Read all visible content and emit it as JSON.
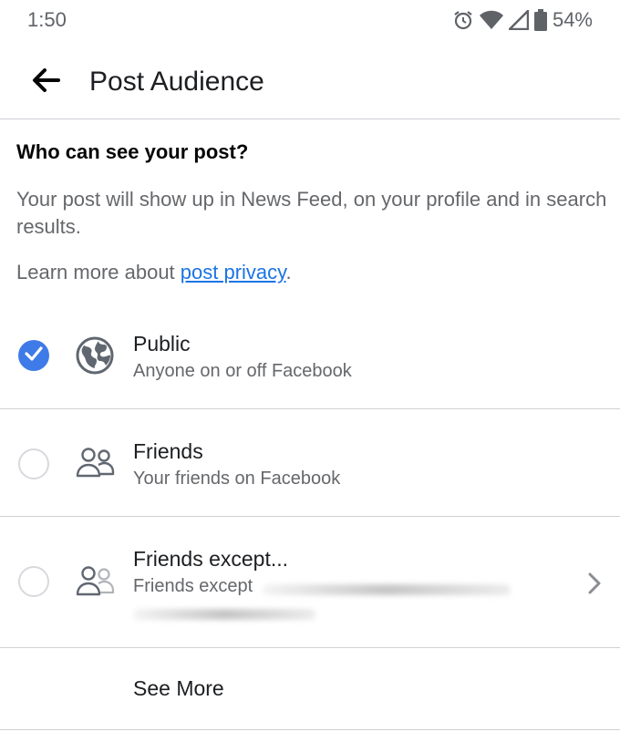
{
  "status_bar": {
    "time": "1:50",
    "battery": "54%",
    "icons": [
      "alarm-icon",
      "wifi-icon",
      "signal-icon",
      "battery-icon"
    ]
  },
  "header": {
    "title": "Post Audience",
    "back_icon": "back-arrow-icon"
  },
  "content": {
    "question": "Who can see your post?",
    "description": "Your post will show up in News Feed, on your profile and in search results.",
    "learn_prefix": "Learn more about ",
    "learn_link": "post privacy",
    "learn_suffix": "."
  },
  "options": [
    {
      "title": "Public",
      "subtitle": "Anyone on or off Facebook",
      "icon": "globe-icon",
      "selected": true
    },
    {
      "title": "Friends",
      "subtitle": "Your friends on Facebook",
      "icon": "friends-icon",
      "selected": false
    },
    {
      "title": "Friends except...",
      "subtitle": "Friends except",
      "icon": "friends-except-icon",
      "selected": false
    }
  ],
  "see_more": "See More",
  "colors": {
    "accent": "#3f7be8",
    "link": "#1b74e4",
    "divider": "#ced0d4",
    "secondary_text": "#65676b"
  }
}
